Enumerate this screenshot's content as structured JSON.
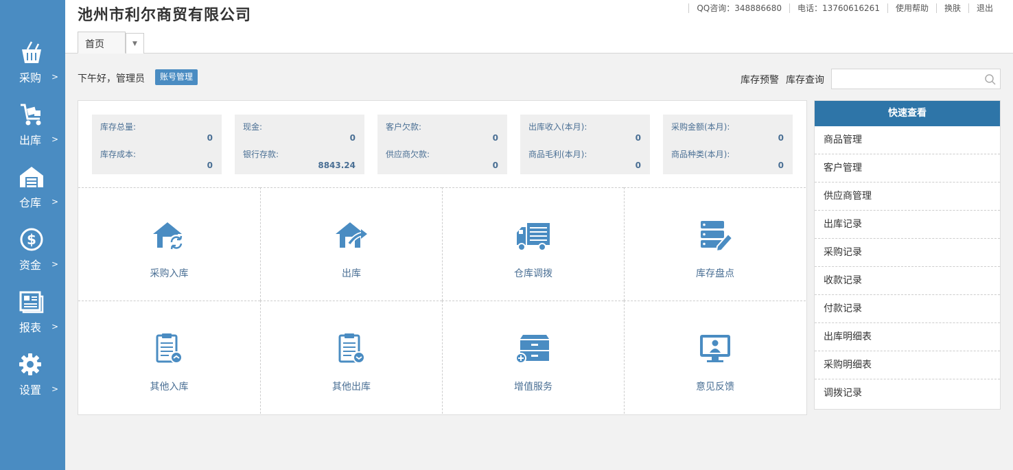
{
  "company": "池州市利尔商贸有限公司",
  "toplinks": [
    "QQ咨询：348886680",
    "电话：13760616261",
    "使用帮助",
    "换肤",
    "退出"
  ],
  "tab": {
    "home": "首页",
    "dropdown_icon": "caret-down-icon"
  },
  "sidebar": {
    "arrow": ">",
    "items": [
      {
        "label": "采购",
        "icon": "basket-icon"
      },
      {
        "label": "出库",
        "icon": "cart-icon"
      },
      {
        "label": "仓库",
        "icon": "warehouse-icon"
      },
      {
        "label": "资金",
        "icon": "dollar-icon"
      },
      {
        "label": "报表",
        "icon": "report-icon"
      },
      {
        "label": "设置",
        "icon": "gear-icon"
      }
    ]
  },
  "greeting": "下午好，管理员",
  "account_button": "账号管理",
  "stock_warning": "库存预警",
  "stock_query": "库存查询",
  "search": {
    "value": "",
    "placeholder": ""
  },
  "stats": [
    {
      "l1": "库存总量:",
      "v1": "0",
      "l2": "库存成本:",
      "v2": "0"
    },
    {
      "l1": "现金:",
      "v1": "0",
      "l2": "银行存款:",
      "v2": "8843.24"
    },
    {
      "l1": "客户欠款:",
      "v1": "0",
      "l2": "供应商欠款:",
      "v2": "0"
    },
    {
      "l1": "出库收入(本月):",
      "v1": "0",
      "l2": "商品毛利(本月):",
      "v2": "0"
    },
    {
      "l1": "采购金额(本月):",
      "v1": "0",
      "l2": "商品种类(本月):",
      "v2": "0"
    }
  ],
  "shortcuts": [
    {
      "label": "采购入库",
      "icon": "purchase-in-icon"
    },
    {
      "label": "出库",
      "icon": "stock-out-icon"
    },
    {
      "label": "仓库调拨",
      "icon": "truck-icon"
    },
    {
      "label": "库存盘点",
      "icon": "inventory-check-icon"
    },
    {
      "label": "其他入库",
      "icon": "clipboard-in-icon"
    },
    {
      "label": "其他出库",
      "icon": "clipboard-out-icon"
    },
    {
      "label": "增值服务",
      "icon": "cabinet-plus-icon"
    },
    {
      "label": "意见反馈",
      "icon": "feedback-monitor-icon"
    }
  ],
  "quick_view": {
    "title": "快速查看",
    "items": [
      "商品管理",
      "客户管理",
      "供应商管理",
      "出库记录",
      "采购记录",
      "收款记录",
      "付款记录",
      "出库明细表",
      "采购明细表",
      "调拨记录"
    ]
  },
  "colors": {
    "sidebar": "#4a8cc2",
    "accent": "#2e75a8",
    "icon": "#4a8cc2"
  }
}
